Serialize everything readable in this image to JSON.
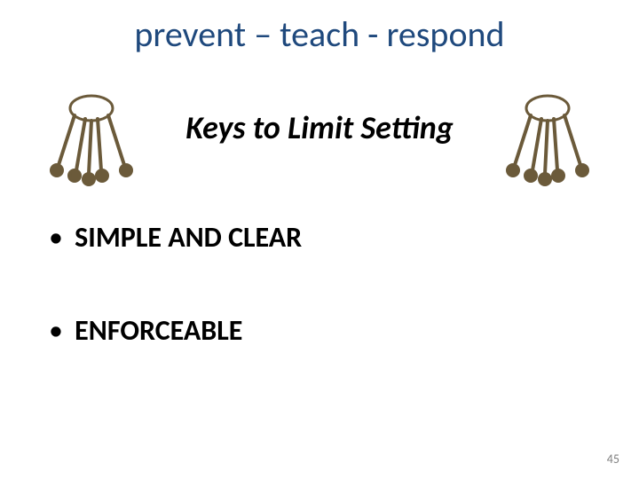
{
  "title": "prevent – teach - respond",
  "subtitle": "Keys to Limit Setting",
  "bullets": [
    "SIMPLE AND CLEAR",
    "ENFORCEABLE"
  ],
  "page_number": "45",
  "icon_name": "keys-icon"
}
